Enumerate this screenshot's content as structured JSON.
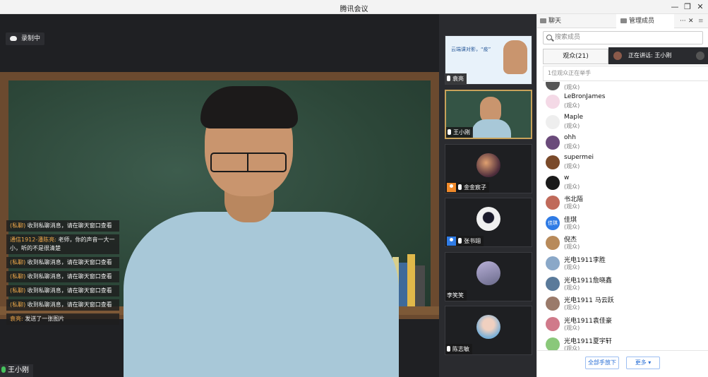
{
  "window": {
    "title": "腾讯会议",
    "minimize_glyph": "—",
    "restore_glyph": "❐",
    "close_glyph": "✕"
  },
  "main": {
    "recording_label": "录制中",
    "speaker_name": "王小刚",
    "chat_messages": [
      {
        "tag": "(私聊)",
        "text": " 收到私聊消息，请在聊天窗口查看"
      },
      {
        "tag": "通信1912-潘陈亮:",
        "text": " 老师，你的声音一大一小，听的不是很清楚"
      },
      {
        "tag": "(私聊)",
        "text": " 收到私聊消息，请在聊天窗口查看"
      },
      {
        "tag": "(私聊)",
        "text": " 收到私聊消息，请在聊天窗口查看"
      },
      {
        "tag": "(私聊)",
        "text": " 收到私聊消息，请在聊天窗口查看"
      },
      {
        "tag": "(私聊)",
        "text": " 收到私聊消息，请在聊天窗口查看"
      },
      {
        "tag": "袁亮:",
        "text": " 发送了一张图片"
      }
    ]
  },
  "thumbnails": [
    {
      "name": "袁亮",
      "slide_title": "云端课对影，“疫”"
    },
    {
      "name": "王小刚"
    },
    {
      "name": "金金宸子"
    },
    {
      "name": "张书翊"
    },
    {
      "name": "李笑笑"
    },
    {
      "name": "陈志敏"
    }
  ],
  "panel": {
    "tab_chat": "聊天",
    "tab_members": "管理成员",
    "more_glyph": "···",
    "close_glyph": "✕",
    "menu_glyph": "≡",
    "search_placeholder": "搜索成员",
    "audience_tab": "观众(21)",
    "speaking_label": "正在讲话: 王小刚",
    "hands_up_text": "1位观众正在举手",
    "partial_role": "(观众)",
    "members": [
      {
        "name": "LeBronJames",
        "role": "(观众)",
        "avatar_color": "#f4d9e6"
      },
      {
        "name": "Maple",
        "role": "(观众)",
        "avatar_color": "#eeeeee"
      },
      {
        "name": "ohh",
        "role": "(观众)",
        "avatar_color": "#6a4a7a"
      },
      {
        "name": "supermei",
        "role": "(观众)",
        "avatar_color": "#7a4a2a"
      },
      {
        "name": "w",
        "role": "(观众)",
        "avatar_color": "#1a1a1a"
      },
      {
        "name": "书北陌",
        "role": "(观众)",
        "avatar_color": "#c06a5a"
      },
      {
        "name": "佳琪",
        "role": "(观众)",
        "avatar_color": "#2f7be5",
        "avatar_text": "佳琪"
      },
      {
        "name": "倪杰",
        "role": "(观众)",
        "avatar_color": "#b88a5a"
      },
      {
        "name": "光电1911李胜",
        "role": "(观众)",
        "avatar_color": "#8aa8c8"
      },
      {
        "name": "光电1911詹晓鑫",
        "role": "(观众)",
        "avatar_color": "#5a7a9a"
      },
      {
        "name": "光电1911 马云跃",
        "role": "(观众)",
        "avatar_color": "#9a7a6a"
      },
      {
        "name": "光电1911袁佳豪",
        "role": "(观众)",
        "avatar_color": "#d07a8a"
      },
      {
        "name": "光电1911夏宇轩",
        "role": "(观众)",
        "avatar_color": "#8ac87a"
      }
    ],
    "footer_release_all": "全部手放下",
    "footer_more": "更多 ▾"
  }
}
